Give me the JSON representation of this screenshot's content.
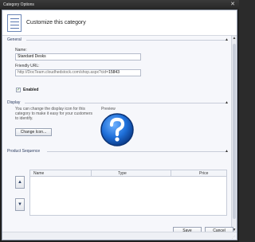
{
  "window": {
    "title": "Category Options",
    "close_glyph": "✕"
  },
  "header": {
    "heading": "Customize this category",
    "icon": "category-list-icon"
  },
  "general": {
    "section_title": "General",
    "name_label": "Name:",
    "name_value": "Standard Desks",
    "url_label": "Friendly URL:",
    "url_prefix": "http://DocTeam.cloudhedstock.com/shop.aspx?cid=",
    "url_value": "15843",
    "enabled_label": "Enabled",
    "enabled_checked": true,
    "collapse_glyph": "▲"
  },
  "display": {
    "section_title": "Display",
    "description": "You can change the display icon for this category to make it easy for your customers to identify.",
    "change_icon_label": "Change Icon...",
    "preview_label": "Preview",
    "collapse_glyph": "▲"
  },
  "product_sequence": {
    "section_title": "Product Sequence",
    "columns": [
      "Name",
      "Type",
      "Price"
    ],
    "move_up_glyph": "▲",
    "move_down_glyph": "▼",
    "collapse_glyph": "▲"
  },
  "footer": {
    "save_label": "Save",
    "cancel_label": "Cancel"
  },
  "scrollbar": {
    "up_glyph": "▲",
    "down_glyph": "▼"
  },
  "colors": {
    "accent": "#1e6fd9",
    "title_bar": "#262626",
    "section_title": "#2f3f62"
  }
}
